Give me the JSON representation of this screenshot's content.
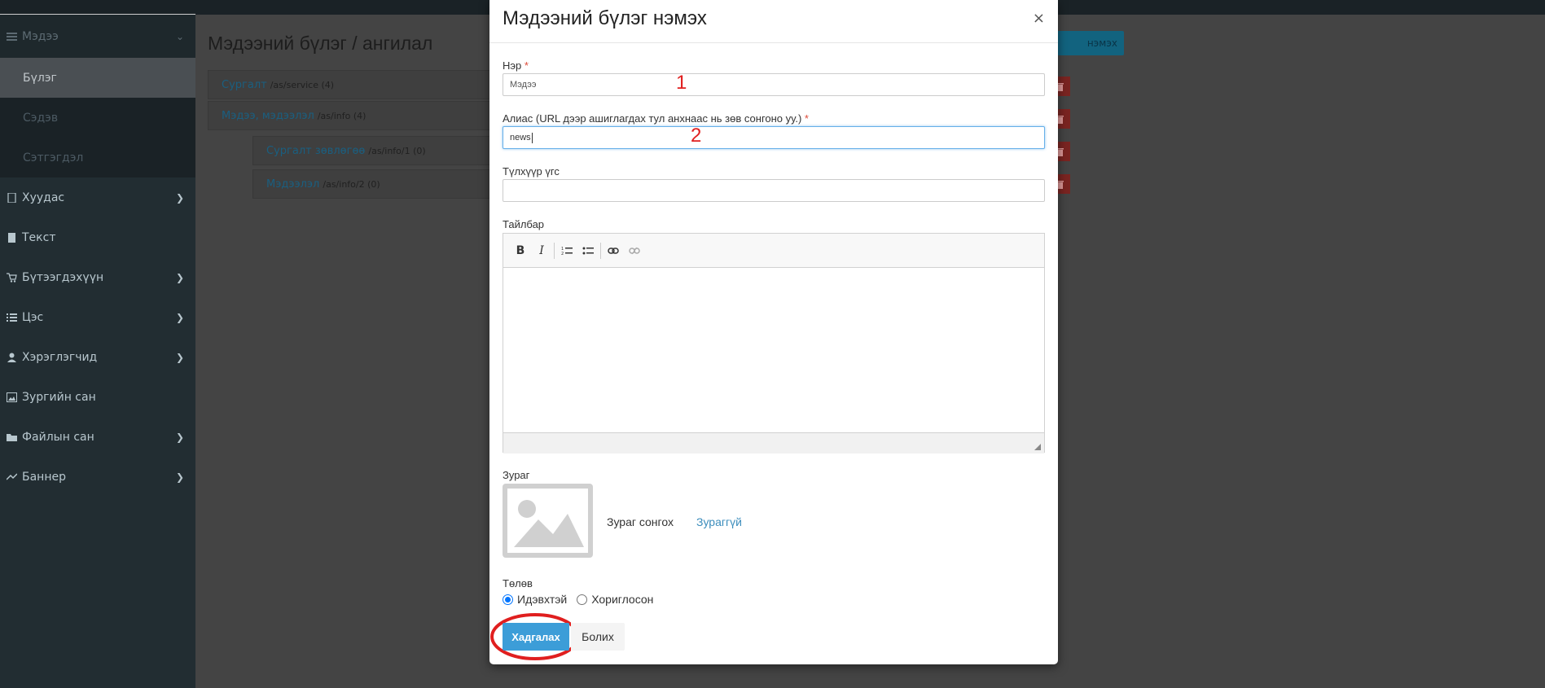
{
  "sidebar": {
    "items": [
      {
        "label": "Мэдээ",
        "icon": "list-icon",
        "expanded": true
      },
      {
        "label": "Хуудас",
        "icon": "file-icon"
      },
      {
        "label": "Текст",
        "icon": "document-icon"
      },
      {
        "label": "Бүтээгдэхүүн",
        "icon": "cart-icon"
      },
      {
        "label": "Цэс",
        "icon": "list-icon"
      },
      {
        "label": "Хэрэглэгчид",
        "icon": "user-icon"
      },
      {
        "label": "Зургийн сан",
        "icon": "image-icon"
      },
      {
        "label": "Файлын сан",
        "icon": "folder-icon"
      },
      {
        "label": "Баннер",
        "icon": "banner-icon"
      }
    ],
    "subitems": [
      "Бүлэг",
      "Сэдэв",
      "Сэтгэгдэл"
    ]
  },
  "main": {
    "title": "Мэдээний бүлэг / ангилал",
    "add_button": "нэмэх",
    "tree": [
      {
        "name": "Сургалт",
        "path": "/as/service (4)"
      },
      {
        "name": "Мэдээ, мэдээлэл",
        "path": "/as/info (4)"
      },
      {
        "name": "Сургалт зөвлөгөө",
        "path": "/as/info/1 (0)"
      },
      {
        "name": "Мэдээлэл",
        "path": "/as/info/2 (0)"
      }
    ]
  },
  "modal": {
    "title": "Мэдээний бүлэг нэмэх",
    "close": "×",
    "name_label": "Нэр",
    "name_value": "Мэдээ",
    "alias_label": "Алиас (URL дээр ашиглагдах тул анхнаас нь зөв сонгоно уу.)",
    "alias_value": "news",
    "keyword_label": "Түлхүүр үгс",
    "keyword_value": "",
    "desc_label": "Тайлбар",
    "image_label": "Зураг",
    "image_choose": "Зураг сонгох",
    "image_none": "Зураггүй",
    "status_label": "Төлөв",
    "status_options": [
      "Идэвхтэй",
      "Хориглосон"
    ],
    "save": "Хадгалах",
    "cancel": "Болих",
    "required_mark": "*"
  },
  "annotations": [
    "1",
    "2"
  ],
  "colors": {
    "accent": "#3c9dd8",
    "annotation": "#e01f1f",
    "sidebar": "#222d32"
  }
}
